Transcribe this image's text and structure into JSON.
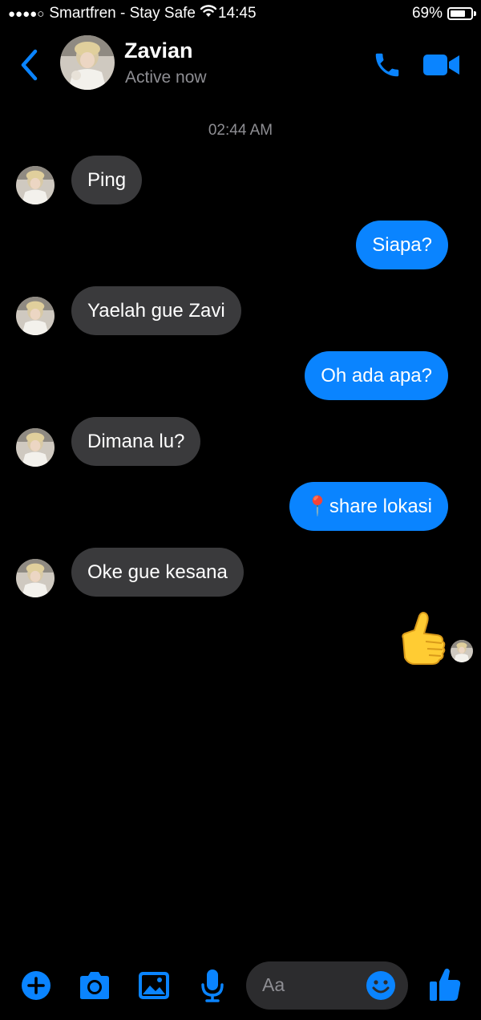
{
  "status_bar": {
    "carrier": "Smartfren - Stay Safe",
    "time": "14:45",
    "battery_percent": "69%",
    "battery_level": 0.69,
    "signal_icon": "signal-dots-icon",
    "wifi_icon": "wifi-icon"
  },
  "header": {
    "name": "Zavian",
    "status": "Active now",
    "back_icon": "chevron-left-icon",
    "call_icon": "phone-icon",
    "video_icon": "video-camera-icon"
  },
  "conversation": {
    "timestamp": "02:44 AM",
    "messages": [
      {
        "from": "them",
        "text": "Ping"
      },
      {
        "from": "me",
        "text": "Siapa?"
      },
      {
        "from": "them",
        "text": "Yaelah gue Zavi"
      },
      {
        "from": "me",
        "text": "Oh ada apa?"
      },
      {
        "from": "them",
        "text": "Dimana lu?"
      },
      {
        "from": "me",
        "text": "📍share lokasi"
      },
      {
        "from": "them",
        "text": "Oke gue kesana"
      },
      {
        "from": "me",
        "text": "👍",
        "type": "emoji"
      }
    ]
  },
  "composer": {
    "placeholder": "Aa",
    "icons": [
      "plus-icon",
      "camera-icon",
      "image-icon",
      "microphone-icon",
      "emoji-icon",
      "thumbs-up-icon"
    ]
  },
  "colors": {
    "accent": "#0a84ff",
    "incoming_bubble": "#3a3a3c",
    "background": "#000000",
    "secondary_text": "#8e8e93"
  }
}
